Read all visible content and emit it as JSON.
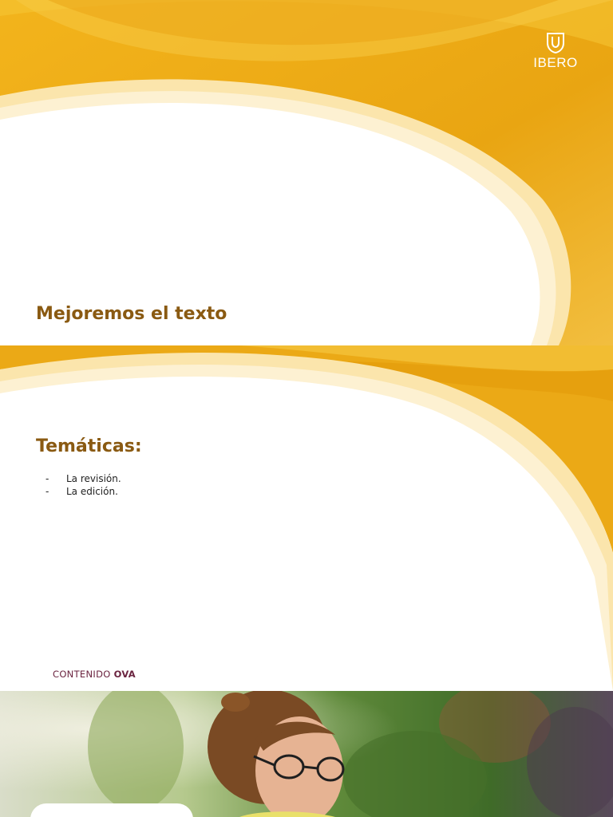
{
  "slide1": {
    "logo": {
      "text": "IBERO",
      "icon": "ibero-shield-icon"
    },
    "title": "Mejoremos el texto"
  },
  "slide2": {
    "heading": "Temáticas:",
    "topics": [
      {
        "bullet": "-",
        "text": "La revisión."
      },
      {
        "bullet": "-",
        "text": "La edición."
      }
    ],
    "footer": {
      "prefix": "CONTENIDO",
      "strong": "OVA"
    }
  },
  "slide3": {
    "image": "woman-with-glasses-photo"
  },
  "colors": {
    "gold_dark": "#e6a00f",
    "gold_light": "#f5cf64",
    "cream": "#fbe5ac",
    "title_brown": "#8a5a12",
    "footer_maroon": "#6b2440"
  }
}
